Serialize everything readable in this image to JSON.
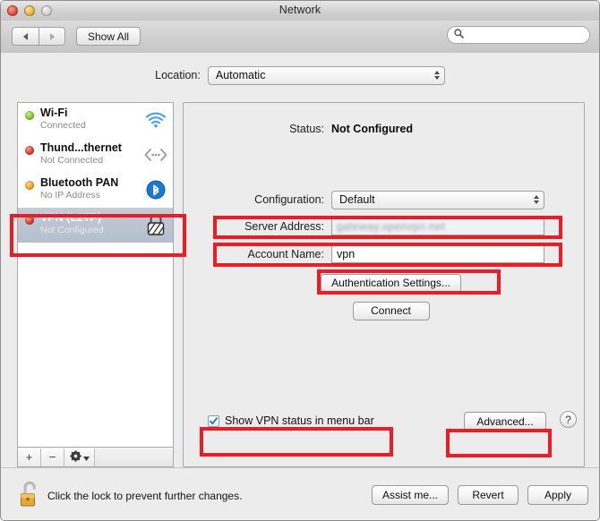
{
  "window": {
    "title": "Network",
    "traffic_lights": [
      "close",
      "minimize",
      "zoom"
    ]
  },
  "toolbar": {
    "back_label": "",
    "forward_label": "",
    "show_all_label": "Show All",
    "search_value": "",
    "search_placeholder": ""
  },
  "location": {
    "label": "Location:",
    "value": "Automatic"
  },
  "sidebar": {
    "services": [
      {
        "name": "Wi-Fi",
        "status": "Connected",
        "dot": "green",
        "icon": "wifi-icon",
        "selected": false
      },
      {
        "name": "Thund...thernet",
        "status": "Not Connected",
        "dot": "red",
        "icon": "thunderbolt-ethernet-icon",
        "selected": false
      },
      {
        "name": "Bluetooth PAN",
        "status": "No IP Address",
        "dot": "orange",
        "icon": "bluetooth-icon",
        "selected": false
      },
      {
        "name": "VPN (L2TP)",
        "status": "Not Configured",
        "dot": "red",
        "icon": "vpn-lock-icon",
        "selected": true
      }
    ],
    "footer": {
      "add_label": "+",
      "remove_label": "−",
      "action_label": "gear"
    }
  },
  "detail": {
    "status_label": "Status:",
    "status_value": "Not Configured",
    "configuration_label": "Configuration:",
    "configuration_value": "Default",
    "server_address_label": "Server Address:",
    "server_address_value": "gateway.openvpn.net",
    "account_name_label": "Account Name:",
    "account_name_value": "vpn",
    "auth_settings_label": "Authentication Settings...",
    "connect_label": "Connect",
    "show_status_label": "Show VPN status in menu bar",
    "show_status_checked": true,
    "advanced_label": "Advanced...",
    "help_label": "?"
  },
  "bottom": {
    "lock_text": "Click the lock to prevent further changes.",
    "assist_label": "Assist me...",
    "revert_label": "Revert",
    "apply_label": "Apply"
  },
  "annotations": {
    "color": "#ec1c24",
    "boxes": [
      "vpn-service-row",
      "server-address-row",
      "account-name-row",
      "authentication-settings-button",
      "show-vpn-status-checkbox",
      "advanced-button"
    ]
  }
}
